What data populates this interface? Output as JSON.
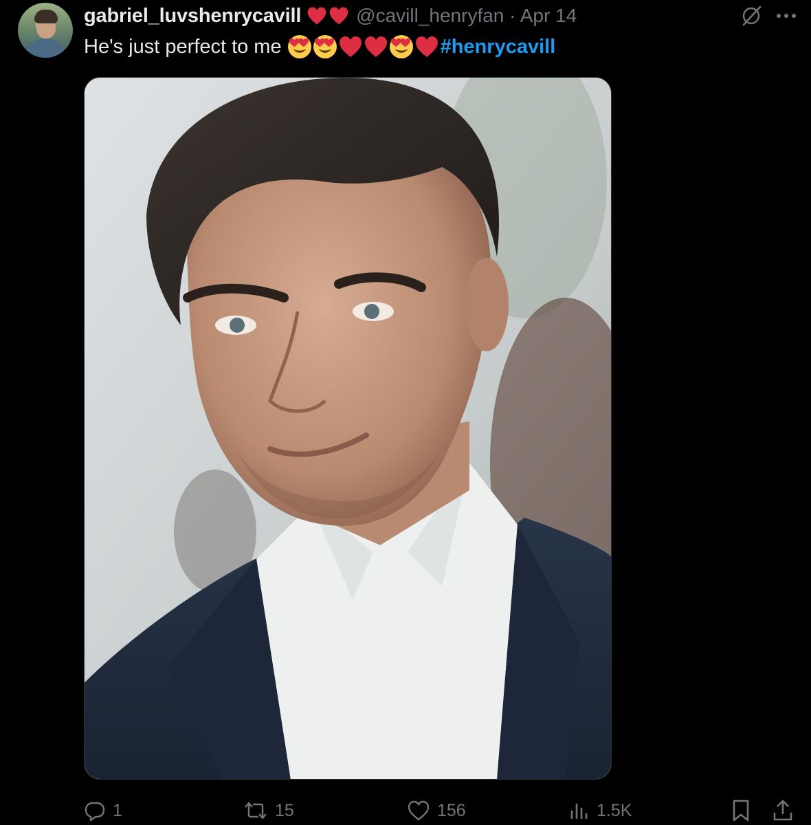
{
  "post": {
    "display_name": "gabriel_luvshenrycavill",
    "name_hearts": [
      "heart",
      "heart"
    ],
    "handle": "@cavill_henryfan",
    "separator": "·",
    "date": "Apr 14",
    "text": "He's just perfect to me",
    "text_emojis": [
      "heart-eyes",
      "heart-eyes",
      "heart",
      "heart",
      "heart-eyes",
      "heart"
    ],
    "hashtag": "#henrycavill"
  },
  "stats": {
    "replies": "1",
    "reposts": "15",
    "likes": "156",
    "views": "1.5K"
  },
  "colors": {
    "background": "#000000",
    "text": "#e7e9ea",
    "muted": "#71767b",
    "link": "#1d9bf0",
    "heart": "#e0245e"
  },
  "icons": [
    "grok-icon",
    "more-icon",
    "reply-icon",
    "repost-icon",
    "like-icon",
    "views-icon",
    "bookmark-icon",
    "share-icon"
  ]
}
